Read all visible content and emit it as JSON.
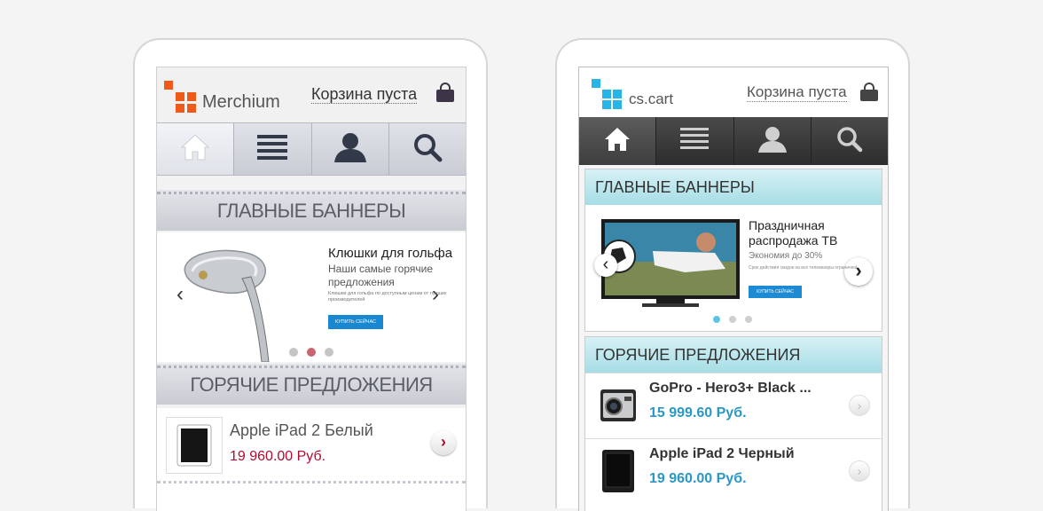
{
  "merchium": {
    "logo_text": "Merchium",
    "cart_label": "Корзина пуста",
    "nav": [
      "home-icon",
      "menu-icon",
      "user-icon",
      "search-icon"
    ],
    "banners_title": "ГЛАВНЫЕ БАННЕРЫ",
    "banner": {
      "title": "Клюшки для гольфа",
      "subtitle": "Наши самые горячие предложения",
      "small_text": "Клюшки для гольфа по доступным ценам от лучших производителей",
      "button_label": "КУПИТЬ СЕЙЧАС",
      "active_dot": 2,
      "total_dots": 3
    },
    "hot_title": "ГОРЯЧИЕ ПРЕДЛОЖЕНИЯ",
    "product": {
      "name": "Apple iPad 2 Белый",
      "price": "19 960.00 Руб."
    },
    "colors": {
      "logo": "#ef5a18",
      "price": "#b00b30"
    }
  },
  "cscart": {
    "logo_text": "cs.cart",
    "cart_label": "Корзина пуста",
    "nav": [
      "home-icon",
      "menu-icon",
      "user-icon",
      "search-icon"
    ],
    "banners_title": "ГЛАВНЫЕ БАННЕРЫ",
    "banner": {
      "title": "Праздничная распродажа ТВ",
      "subtitle": "Экономия до 30%",
      "small_text": "Срок действия скидок на все телевизоры ограничен!",
      "button_label": "КУПИТЬ СЕЙЧАС",
      "active_dot": 1,
      "total_dots": 3
    },
    "hot_title": "ГОРЯЧИЕ ПРЕДЛОЖЕНИЯ",
    "products": [
      {
        "name": "GoPro - Hero3+ Black ...",
        "price": "15 999.60 Руб."
      },
      {
        "name": "Apple iPad 2 Черный",
        "price": "19 960.00 Руб."
      }
    ],
    "colors": {
      "logo": "#26b5e8",
      "price": "#2a97c4",
      "section": "#a6dde5"
    }
  }
}
